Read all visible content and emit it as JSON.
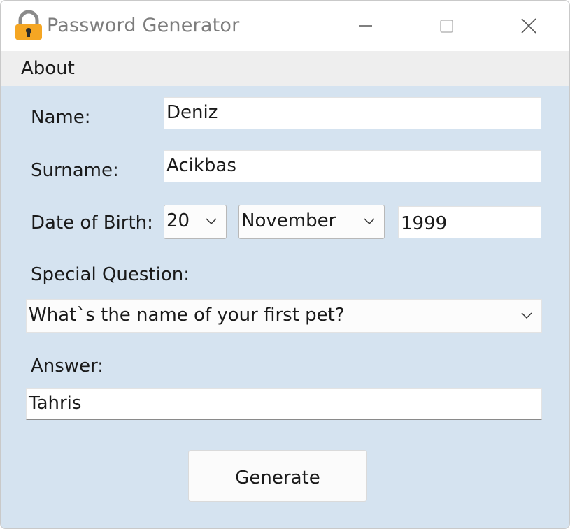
{
  "window": {
    "title": "Password Generator",
    "icon": "padlock-icon",
    "controls": [
      "minimize-icon",
      "maximize-icon",
      "close-icon"
    ]
  },
  "menu": {
    "items": [
      {
        "label": "About"
      }
    ]
  },
  "form": {
    "name_label": "Name:",
    "name_value": "Deniz",
    "surname_label": "Surname:",
    "surname_value": "Acikbas",
    "dob_label": "Date of Birth:",
    "dob_day": "20",
    "dob_month": "November",
    "dob_year": "1999",
    "question_label": "Special Question:",
    "question_value": "What`s the name of your first pet?",
    "answer_label": "Answer:",
    "answer_value": "Tahris",
    "generate_label": "Generate"
  },
  "colors": {
    "background": "#d5e3f0",
    "titlebar": "#ffffff",
    "menubar": "#eeeeee",
    "lock_body": "#f5a623"
  }
}
